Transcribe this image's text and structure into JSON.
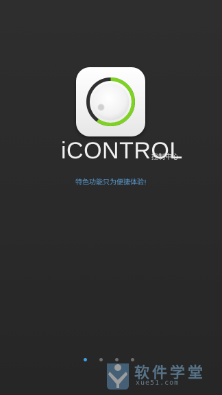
{
  "app": {
    "brand": "iCONTROL",
    "brand_sub": "控制中心",
    "tagline": "特色功能只为便捷体验!"
  },
  "icon": {
    "name": "knob-dial-icon",
    "ring_color": "#7ed321",
    "ring_track_color": "#333333"
  },
  "pager": {
    "pages": 4,
    "active_index": 0,
    "active_color": "#3aa3e8"
  },
  "watermark": {
    "title": "软件学堂",
    "url": "xue51.com"
  }
}
